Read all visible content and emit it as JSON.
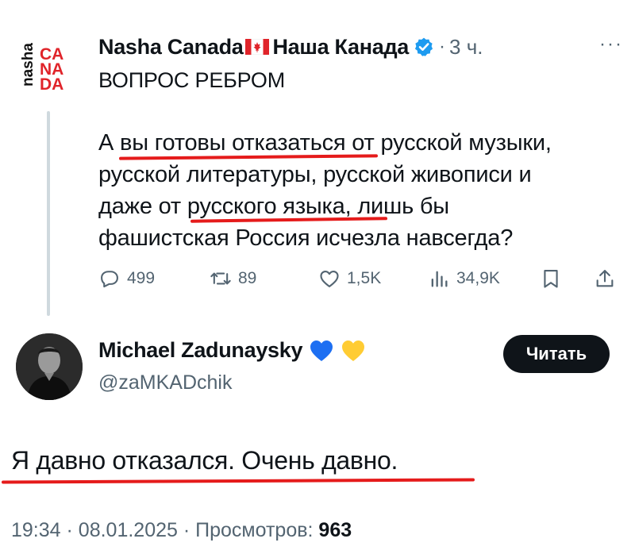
{
  "colors": {
    "text_primary": "#0f1419",
    "text_secondary": "#536471",
    "verified_blue": "#1d9bf0",
    "annotation_red": "#e51b1b",
    "follow_button_bg": "#0f1419"
  },
  "source_post": {
    "author_name_latin": "Nasha Canada",
    "author_name_cyrillic": "Наша Канада",
    "flag_icon": "canada-flag-icon",
    "verified_icon": "verified-badge-icon",
    "separator": "·",
    "time": "3 ч.",
    "more_label": "···",
    "avatar_text": "nasha CANADA",
    "headline": "ВОПРОС РЕБРОМ",
    "body_lines": [
      "А вы готовы отказаться от русской музыки,",
      "русской литературы, русской живописи и",
      "даже от русского языка, лишь бы",
      "фашистская Россия исчезла навсегда?"
    ],
    "actions": {
      "replies": "499",
      "reposts": "89",
      "likes": "1,5K",
      "views": "34,9K"
    }
  },
  "reply_post": {
    "author_name": "Michael Zadunaysky",
    "hearts": [
      "blue-heart-icon",
      "yellow-heart-icon"
    ],
    "handle": "@zaMKADchik",
    "follow_label": "Читать",
    "text": "Я давно отказался. Очень давно.",
    "time": "19:34",
    "date": "08.01.2025",
    "views_label": "Просмотров:",
    "views_count": "963",
    "separator": "·"
  }
}
